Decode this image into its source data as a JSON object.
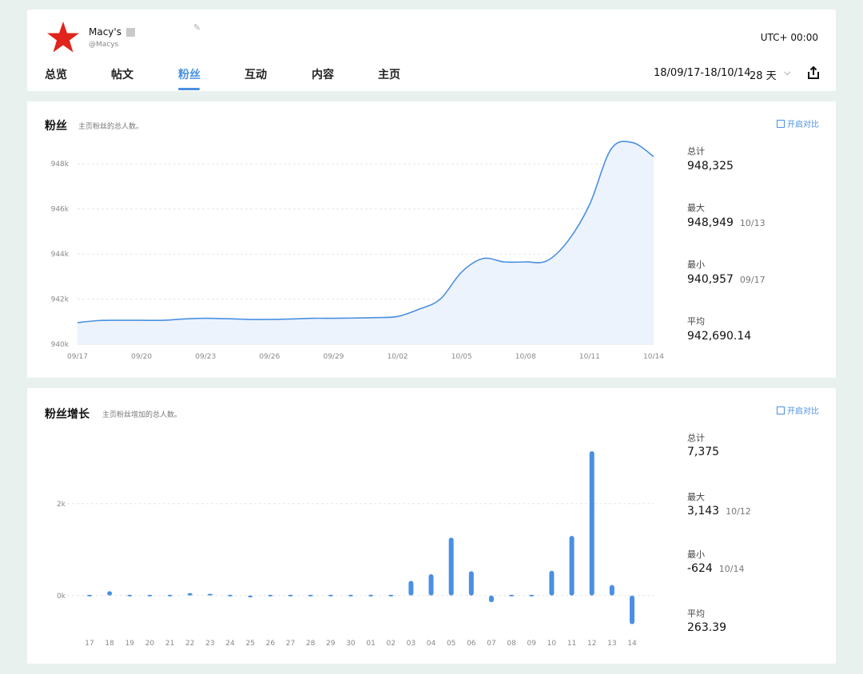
{
  "account": {
    "name": "Macy's",
    "handle": "@Macys",
    "timezone": "UTC+ 00:00"
  },
  "tabs": [
    {
      "label": "总览",
      "active": false
    },
    {
      "label": "帖文",
      "active": false
    },
    {
      "label": "粉丝",
      "active": true
    },
    {
      "label": "互动",
      "active": false
    },
    {
      "label": "内容",
      "active": false
    },
    {
      "label": "主页",
      "active": false
    }
  ],
  "date_range": {
    "range": "18/09/17-18/10/14",
    "days": "28 天"
  },
  "colors": {
    "accent": "#4a90e2",
    "area_fill": "#edf3fc",
    "brand_red": "#e0241b"
  },
  "followers": {
    "title": "粉丝",
    "desc": "主页粉丝的总人数。",
    "compare": "开启对比",
    "stats": {
      "total_label": "总计",
      "total": "948,325",
      "max_label": "最大",
      "max": "948,949",
      "max_date": "10/13",
      "min_label": "最小",
      "min": "940,957",
      "min_date": "09/17",
      "avg_label": "平均",
      "avg": "942,690.14"
    }
  },
  "growth": {
    "title": "粉丝增长",
    "desc": "主页粉丝增加的总人数。",
    "compare": "开启对比",
    "stats": {
      "total_label": "总计",
      "total": "7,375",
      "max_label": "最大",
      "max": "3,143",
      "max_date": "10/12",
      "min_label": "最小",
      "min": "-624",
      "min_date": "10/14",
      "avg_label": "平均",
      "avg": "263.39"
    }
  },
  "chart_data": [
    {
      "type": "area",
      "title": "粉丝",
      "x": [
        "09/17",
        "09/18",
        "09/19",
        "09/20",
        "09/21",
        "09/22",
        "09/23",
        "09/24",
        "09/25",
        "09/26",
        "09/27",
        "09/28",
        "09/29",
        "09/30",
        "10/01",
        "10/02",
        "10/03",
        "10/04",
        "10/05",
        "10/06",
        "10/07",
        "10/08",
        "10/09",
        "10/10",
        "10/11",
        "10/12",
        "10/13",
        "10/14"
      ],
      "xticks": [
        "09/17",
        "09/20",
        "09/23",
        "09/26",
        "09/29",
        "10/02",
        "10/05",
        "10/08",
        "10/11",
        "10/14"
      ],
      "yticks": [
        "940k",
        "942k",
        "944k",
        "946k",
        "948k"
      ],
      "ytick_values": [
        940000,
        942000,
        944000,
        946000,
        948000
      ],
      "values": [
        940957,
        941050,
        941060,
        941060,
        941060,
        941120,
        941150,
        941130,
        941100,
        941100,
        941120,
        941150,
        941150,
        941160,
        941180,
        941230,
        941550,
        942000,
        943200,
        943800,
        943650,
        943650,
        943700,
        944600,
        946200,
        948650,
        948949,
        948325
      ],
      "ylim": [
        940000,
        949000
      ],
      "grid": true
    },
    {
      "type": "bar",
      "title": "粉丝增长",
      "categories": [
        "17",
        "18",
        "19",
        "20",
        "21",
        "22",
        "23",
        "24",
        "25",
        "26",
        "27",
        "28",
        "29",
        "30",
        "01",
        "02",
        "03",
        "04",
        "05",
        "06",
        "07",
        "08",
        "09",
        "10",
        "11",
        "12",
        "13",
        "14"
      ],
      "values": [
        10,
        95,
        10,
        0,
        0,
        55,
        40,
        20,
        -40,
        10,
        30,
        30,
        0,
        10,
        30,
        20,
        320,
        465,
        1260,
        530,
        -145,
        0,
        30,
        540,
        1300,
        3143,
        230,
        -624
      ],
      "yticks": [
        "0k",
        "2k"
      ],
      "ytick_values": [
        0,
        2000
      ],
      "ylim": [
        -700,
        3300
      ],
      "grid": true
    }
  ]
}
